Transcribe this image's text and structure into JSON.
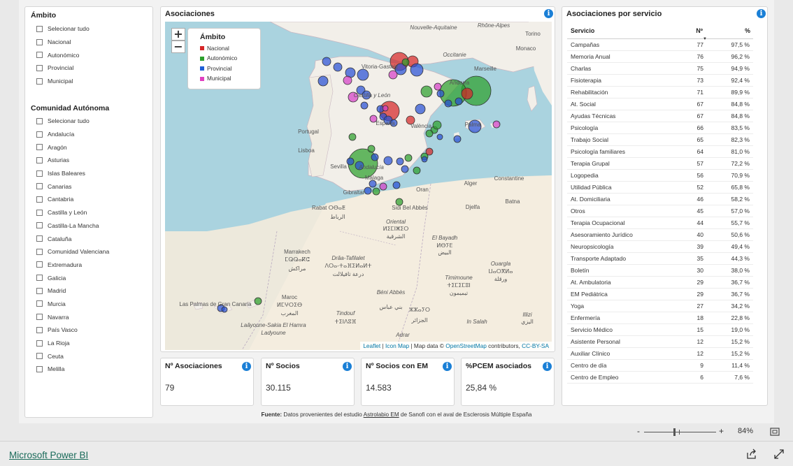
{
  "slicer": {
    "ambito_title": "Ámbito",
    "ambito_items": [
      "Selecionar tudo",
      "Nacional",
      "Autonómico",
      "Provincial",
      "Municipal"
    ],
    "comunidad_title": "Comunidad Autónoma",
    "comunidad_items": [
      "Selecionar tudo",
      "Andalucía",
      "Aragón",
      "Asturias",
      "Islas Baleares",
      "Canarias",
      "Cantabria",
      "Castilla y León",
      "Castilla-La Mancha",
      "Cataluña",
      "Comunidad Valenciana",
      "Extremadura",
      "Galicia",
      "Madrid",
      "Murcia",
      "Navarra",
      "País Vasco",
      "La Rioja",
      "Ceuta",
      "Melilla"
    ]
  },
  "map": {
    "title": "Asociaciones",
    "zoom_in": "+",
    "zoom_out": "−",
    "legend_title": "Ámbito",
    "legend": [
      {
        "label": "Nacional",
        "color": "#d62728"
      },
      {
        "label": "Autonómico",
        "color": "#2ca02c"
      },
      {
        "label": "Provincial",
        "color": "#1f5fd6"
      },
      {
        "label": "Municipal",
        "color": "#e040c0"
      }
    ],
    "places": [
      "Nouvelle-Aquitaine",
      "Rhône-Alpes",
      "Torino",
      "Monaco",
      "Occitanie",
      "Marseille",
      "Andorra",
      "Vitoria-Gasteiz",
      "Castilla y León",
      "Portugal",
      "Lisboa",
      "España",
      "València",
      "Palma",
      "Sevilla",
      "Andalucía",
      "Málaga",
      "Gibraltar",
      "Oran",
      "Constantine",
      "Alger",
      "الجزائر",
      "Rabat ⵔⴱⴰⵟ",
      "الرباط",
      "Sidi Bel Abbès",
      "Djelfa",
      "Batna",
      "Oriental",
      "ⵍⵉⵎⵏⵥⵉⵔ",
      "الشرقية",
      "El Bayadh",
      "ⵍⴱⵢⴹ",
      "البيض",
      "Marrakech",
      "ⵎⵕⵕⴰⴽⵛ",
      "مراكش",
      "Drâa-Tafilalet",
      "ⴷⵔⴰ-ⵜⴰⴼⵉⵍⴰⵍⵜ",
      "درعة تافيلالت",
      "Ouargla",
      "ⵡⴰⵔⴳⵍⴰ",
      "ورقلة",
      "Timimoune",
      "ⵜⵉⵎⵉⵎⵓⵏ",
      "تيميمون",
      "Béni Abbès",
      "بني عباس",
      "Maroc",
      "ⵍⵎⵖⵔⵉⴱ",
      "المغرب",
      "Las Palmas de Gran Canaria",
      "Tindouf",
      "ⵜⵉⵏⴷⵓⴼ",
      "ⵣⵣⴰⵢⵔ",
      "الجزائر",
      "Illizi",
      "اليزي",
      "Laâyoune-Sakia El Hamra",
      "Adrar",
      "In Salah",
      "Ladyoune"
    ],
    "attribution_leaflet": "Leaflet",
    "attribution_icon": "Icon Map",
    "attribution_mid": "| Map data ©",
    "attribution_osm": "OpenStreetMap",
    "attribution_end": "contributors,",
    "attribution_cc": "CC-BY-SA"
  },
  "kpis": [
    {
      "label": "Nº Asociaciones",
      "value": "79"
    },
    {
      "label": "Nº Socios",
      "value": "30.115"
    },
    {
      "label": "Nº Socios con EM",
      "value": "14.583"
    },
    {
      "label": "%PCEM asociados",
      "value": "25,84 %"
    }
  ],
  "services": {
    "title": "Asociaciones por servicio",
    "columns": [
      "Servicio",
      "Nº",
      "%"
    ],
    "rows": [
      [
        "Campañas",
        "77",
        "97,5 %"
      ],
      [
        "Memoria Anual",
        "76",
        "96,2 %"
      ],
      [
        "Charlas",
        "75",
        "94,9 %"
      ],
      [
        "Fisioterapia",
        "73",
        "92,4 %"
      ],
      [
        "Rehabilitación",
        "71",
        "89,9 %"
      ],
      [
        "At. Social",
        "67",
        "84,8 %"
      ],
      [
        "Ayudas Técnicas",
        "67",
        "84,8 %"
      ],
      [
        "Psicología",
        "66",
        "83,5 %"
      ],
      [
        "Trabajo Social",
        "65",
        "82,3 %"
      ],
      [
        "Psicología familiares",
        "64",
        "81,0 %"
      ],
      [
        "Terapia Grupal",
        "57",
        "72,2 %"
      ],
      [
        "Logopedia",
        "56",
        "70,9 %"
      ],
      [
        "Utilidad Pública",
        "52",
        "65,8 %"
      ],
      [
        "At. Domiciliaria",
        "46",
        "58,2 %"
      ],
      [
        "Otros",
        "45",
        "57,0 %"
      ],
      [
        "Terapia Ocupacional",
        "44",
        "55,7 %"
      ],
      [
        "Asesoramiento Jurídico",
        "40",
        "50,6 %"
      ],
      [
        "Neuropsicología",
        "39",
        "49,4 %"
      ],
      [
        "Transporte Adaptado",
        "35",
        "44,3 %"
      ],
      [
        "Boletín",
        "30",
        "38,0 %"
      ],
      [
        "At. Ambulatoria",
        "29",
        "36,7 %"
      ],
      [
        "EM Pediátrica",
        "29",
        "36,7 %"
      ],
      [
        "Yoga",
        "27",
        "34,2 %"
      ],
      [
        "Enfermería",
        "18",
        "22,8 %"
      ],
      [
        "Servicio Médico",
        "15",
        "19,0 %"
      ],
      [
        "Asistente Personal",
        "12",
        "15,2 %"
      ],
      [
        "Auxiliar Clínico",
        "12",
        "15,2 %"
      ],
      [
        "Centro de día",
        "9",
        "11,4 %"
      ],
      [
        "Centro de Empleo",
        "6",
        "7,6 %"
      ]
    ]
  },
  "fuente": {
    "bold": "Fuente:",
    "text1": "Datos provenientes del estudio",
    "link": "Astrolabio EM",
    "text2": "de Sanofi con el aval de Esclerosis Múltiple España"
  },
  "zoom": {
    "minus": "-",
    "plus": "+",
    "level": "84%"
  },
  "footer": {
    "brand": "Microsoft Power BI"
  },
  "colors": {
    "accent": "#1a7fd6",
    "brand": "#1a6b5a",
    "sea": "#aad3df",
    "land": "#f2efe9"
  }
}
